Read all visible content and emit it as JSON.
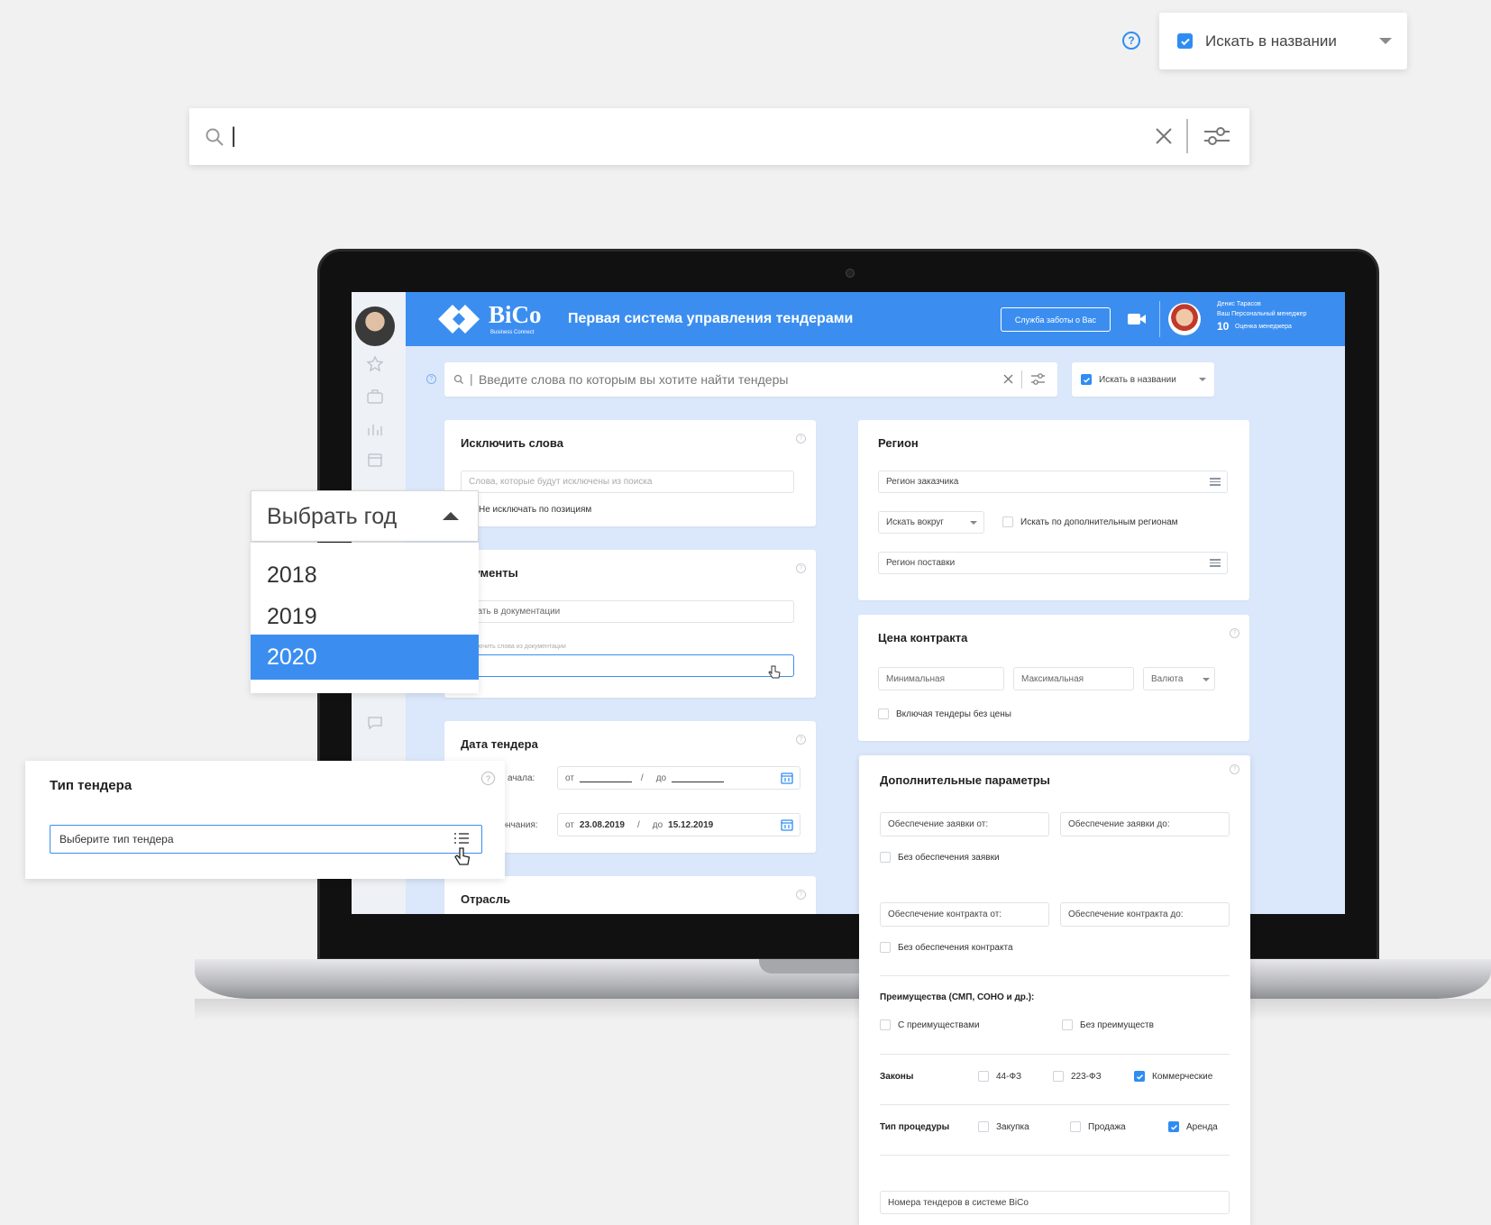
{
  "top_controls": {
    "help_symbol": "?",
    "search_in_title_label": "Искать в названии",
    "search_in_title_checked": true
  },
  "main_search": {
    "value": "|"
  },
  "year_dropdown": {
    "label": "Выбрать год",
    "options": [
      "2018",
      "2019",
      "2020"
    ],
    "selected": "2020"
  },
  "tender_type_card": {
    "title": "Тип тендера",
    "help_symbol": "?",
    "placeholder": "Выберите тип тендера"
  },
  "app": {
    "logo_text": "BiCo",
    "logo_subtext": "Business Connect",
    "header_title": "Первая система управления тендерами",
    "support_button": "Служба заботы о Вас",
    "manager_name": "Денис Тарасов",
    "manager_role": "Ваш Персональный менеджер",
    "manager_score": "10",
    "manager_score_label": "Оценка менеджера",
    "search_placeholder": "Введите слова по которым вы хотите найти тендеры",
    "search_in_title_label": "Искать в названии",
    "exclude_words": {
      "title": "Исключить слова",
      "placeholder": "Слова, которые будут исключены из поиска",
      "checkbox": "Не исключать по позициям"
    },
    "documents": {
      "title": "окументы",
      "field1": "скать в документации",
      "field2_label": "ключить слова из документации"
    },
    "tender_date": {
      "title": "Дата тендера",
      "row1_label": "ачала:",
      "row1_from": "от",
      "row1_to": "до",
      "row2_label": "кончания:",
      "row2_from": "от",
      "row2_from_value": "23.08.2019",
      "row2_to": "до",
      "row2_to_value": "15.12.2019",
      "separator": "/"
    },
    "industry": {
      "title": "Отрасль"
    },
    "region": {
      "title": "Регион",
      "customer_region": "Регион заказчика",
      "search_around": "Искать вокруг",
      "additional_regions": "Искать по дополнительным регионам",
      "delivery_region": "Регион поставки"
    },
    "contract_price": {
      "title": "Цена контракта",
      "min": "Минимальная",
      "max": "Максимальная",
      "currency": "Валюта",
      "include_no_price": "Включая тендеры без цены"
    },
    "extra_params": {
      "title": "Дополнительные параметры",
      "bid_security_from": "Обеспечение заявки от:",
      "bid_security_to": "Обеспечение заявки до:",
      "no_bid_security": "Без обеспечения заявки",
      "contract_security_from": "Обеспечение контракта от:",
      "contract_security_to": "Обеспечение контракта до:",
      "no_contract_security": "Без обеспечения контракта",
      "advantages_title": "Преимущества (СМП, СОНО и др.):",
      "with_advantages": "С преимуществами",
      "without_advantages": "Без преимуществ",
      "laws_label": "Законы",
      "law_44": "44-ФЗ",
      "law_223": "223-ФЗ",
      "law_commercial": "Коммерческие",
      "procedure_label": "Тип процедуры",
      "proc_purchase": "Закупка",
      "proc_sale": "Продажа",
      "proc_rent": "Аренда",
      "tender_numbers": "Номера тендеров в системе BiCo"
    }
  },
  "colors": {
    "accent": "#2f8df2",
    "header_blue": "#3b8ef0",
    "screen_bg": "#dbe8fb"
  }
}
